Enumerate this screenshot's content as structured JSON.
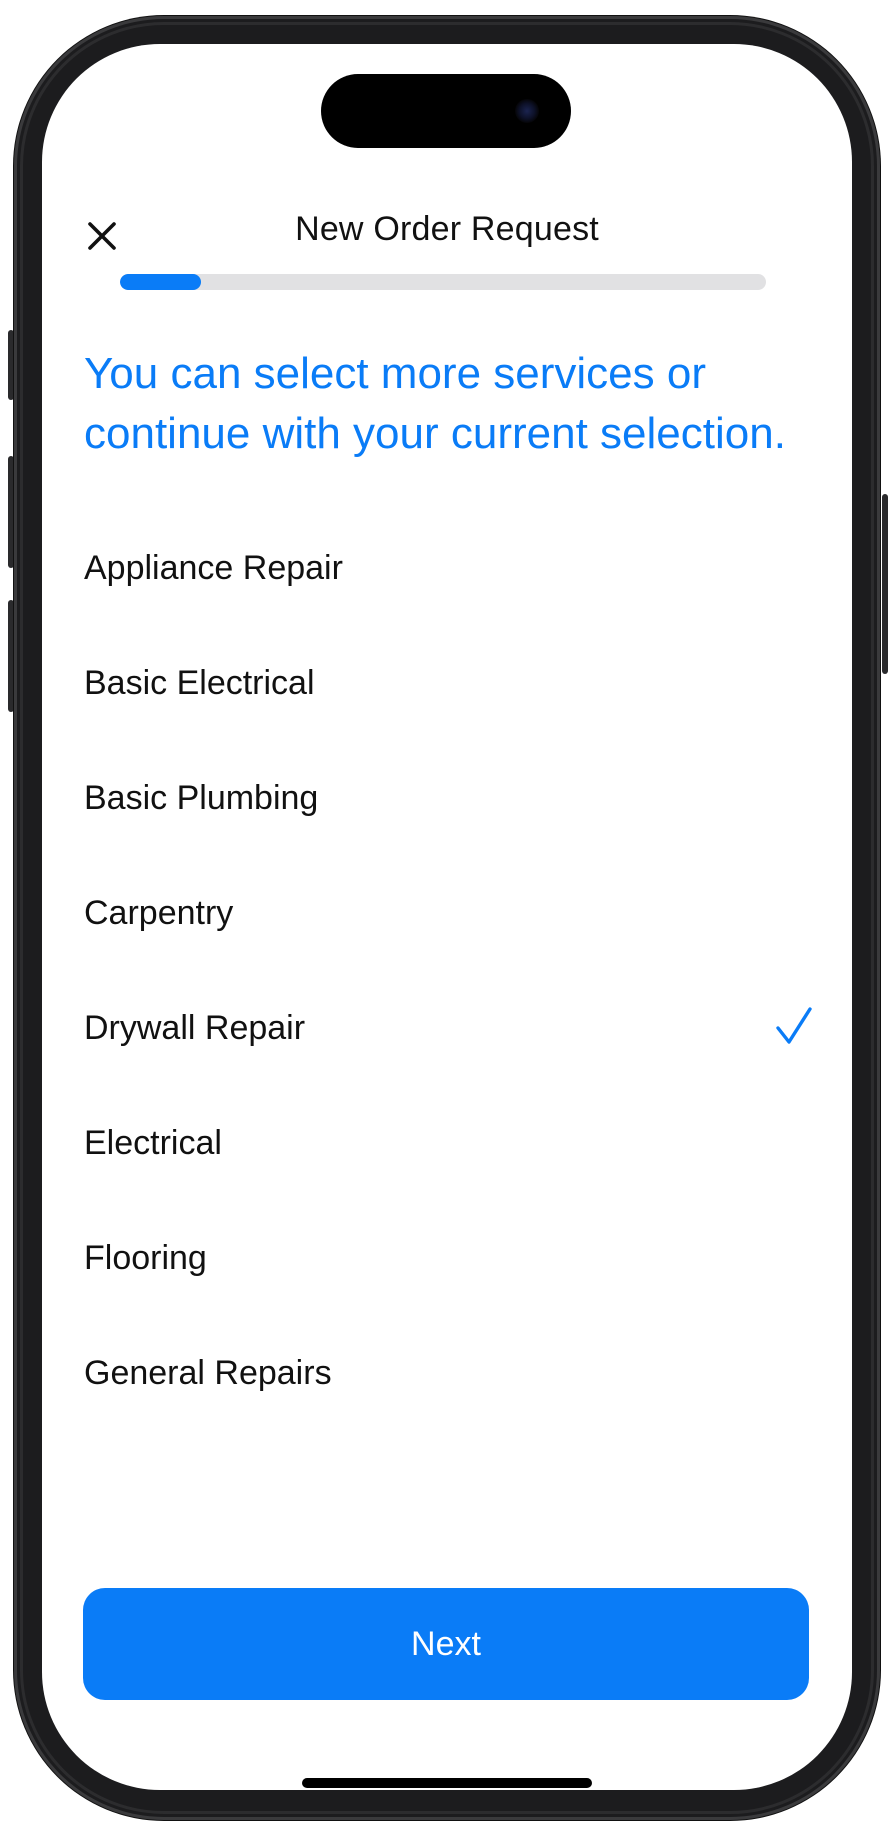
{
  "header": {
    "title": "New Order Request",
    "close_icon": "close-icon"
  },
  "progress": {
    "fraction": 0.125,
    "color": "#0a7cf7",
    "track_color": "#e1e1e3"
  },
  "main": {
    "headline": "You can select more services or continue with your current selection.",
    "services": [
      {
        "label": "Appliance Repair",
        "selected": false
      },
      {
        "label": "Basic Electrical",
        "selected": false
      },
      {
        "label": "Basic Plumbing",
        "selected": false
      },
      {
        "label": "Carpentry",
        "selected": false
      },
      {
        "label": "Drywall Repair",
        "selected": true
      },
      {
        "label": "Electrical",
        "selected": false
      },
      {
        "label": "Flooring",
        "selected": false
      },
      {
        "label": "General Repairs",
        "selected": false
      }
    ],
    "check_icon": "checkmark-icon"
  },
  "footer": {
    "next_label": "Next"
  },
  "colors": {
    "accent": "#0a7cf7",
    "text": "#111111",
    "background": "#ffffff"
  }
}
